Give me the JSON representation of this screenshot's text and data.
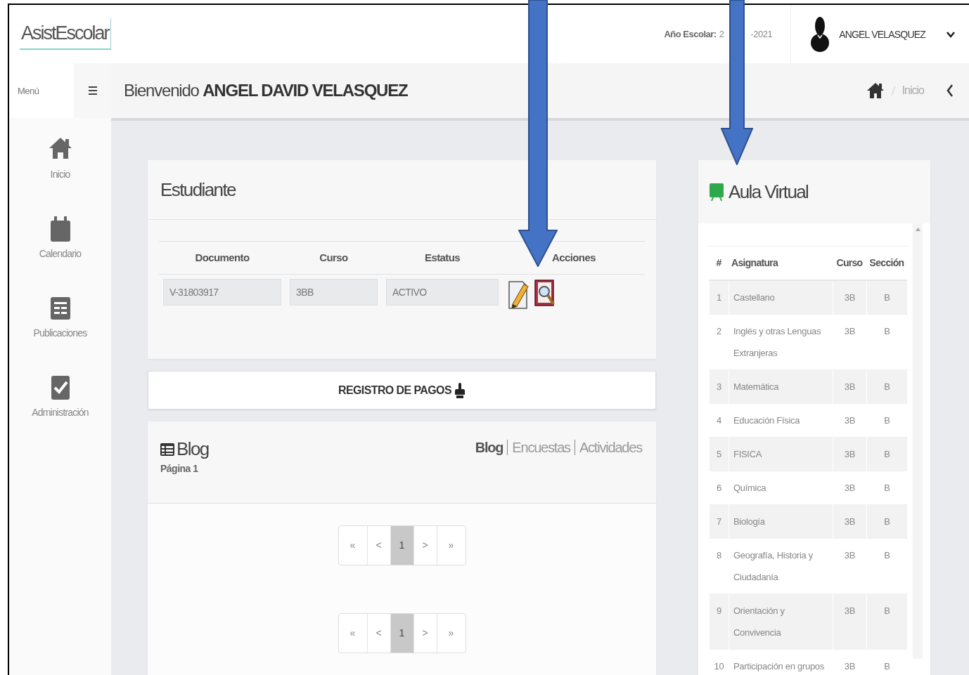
{
  "header": {
    "logo": "AsistEscolar",
    "school_year_label": "Año Escolar:",
    "school_year_parts": [
      "2",
      "-2021"
    ],
    "user_name": "ANGEL VELASQUEZ"
  },
  "sidebar": {
    "menu_label": "Menú",
    "items": [
      {
        "label": "Inicio"
      },
      {
        "label": "Calendario"
      },
      {
        "label": "Publicaciones"
      },
      {
        "label": "Administración"
      }
    ]
  },
  "title_bar": {
    "greeting": "Bienvenido **ANGEL DAVID VELASQUEZ**",
    "breadcrumb": [
      "Inicio"
    ]
  },
  "student_card": {
    "title": "Estudiante",
    "columns": [
      "Documento",
      "Curso",
      "Estatus",
      "Acciones"
    ],
    "row": {
      "documento": "V-31803917",
      "curso": "3BB",
      "estatus": "ACTIVO"
    }
  },
  "payments_button": {
    "label": "REGISTRO DE PAGOS"
  },
  "blog": {
    "title": "Blog",
    "subtitle": "Página 1",
    "tabs": [
      {
        "label": "Blog",
        "selected": true
      },
      {
        "label": "Encuestas",
        "selected": false
      },
      {
        "label": "Actividades",
        "selected": false
      }
    ],
    "paginations": [
      {
        "pages": [
          {
            "label": "«",
            "selected": false
          },
          {
            "label": "<",
            "selected": false
          },
          {
            "label": "1",
            "selected": true
          },
          {
            "label": ">",
            "selected": false
          },
          {
            "label": "»",
            "selected": false
          }
        ]
      },
      {
        "pages": [
          {
            "label": "«",
            "selected": false
          },
          {
            "label": "<",
            "selected": false
          },
          {
            "label": "1",
            "selected": true
          },
          {
            "label": ">",
            "selected": false
          },
          {
            "label": "»",
            "selected": false
          }
        ]
      }
    ]
  },
  "aula_virtual": {
    "title": "Aula Virtual",
    "columns": [
      "#",
      "Asignatura",
      "Curso",
      "Sección"
    ],
    "rows": [
      [
        "1",
        "Castellano",
        "3B",
        "B"
      ],
      [
        "2",
        "Inglés y otras Lenguas Extranjeras",
        "3B",
        "B"
      ],
      [
        "3",
        "Matemática",
        "3B",
        "B"
      ],
      [
        "4",
        "Educación Física",
        "3B",
        "B"
      ],
      [
        "5",
        "FISICA",
        "3B",
        "B"
      ],
      [
        "6",
        "Química",
        "3B",
        "B"
      ],
      [
        "7",
        "Biología",
        "3B",
        "B"
      ],
      [
        "8",
        "Geografía, Historia y Ciudadanía",
        "3B",
        "B"
      ],
      [
        "9",
        "Orientación y Convivencia",
        "3B",
        "B"
      ],
      [
        "10",
        "Participación en grupos",
        "3B",
        "B"
      ]
    ]
  },
  "overlay_arrows": [
    {
      "kind": "down"
    },
    {
      "kind": "down"
    }
  ]
}
